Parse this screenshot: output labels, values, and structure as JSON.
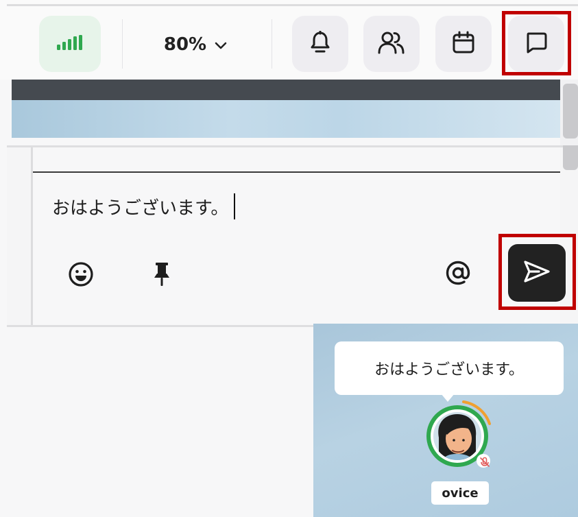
{
  "toolbar": {
    "zoom_level": "80%",
    "buttons": {
      "signal": "signal-strength-icon",
      "notifications": "bell-icon",
      "members": "people-icon",
      "calendar": "calendar-icon",
      "chat": "chat-bubble-icon"
    }
  },
  "composer": {
    "message_value": "おはようございます。",
    "actions": [
      "emoji-icon",
      "pin-icon",
      "mention-icon",
      "send-icon"
    ]
  },
  "space": {
    "speech_bubble_text": "おはようございます。",
    "user_name": "ovice"
  },
  "colors": {
    "highlight": "#c00000",
    "signal_green": "#2fa84f",
    "send_button": "#222222",
    "avatar_ring": "#2fa84f",
    "speaking_arc": "#f0a030"
  }
}
